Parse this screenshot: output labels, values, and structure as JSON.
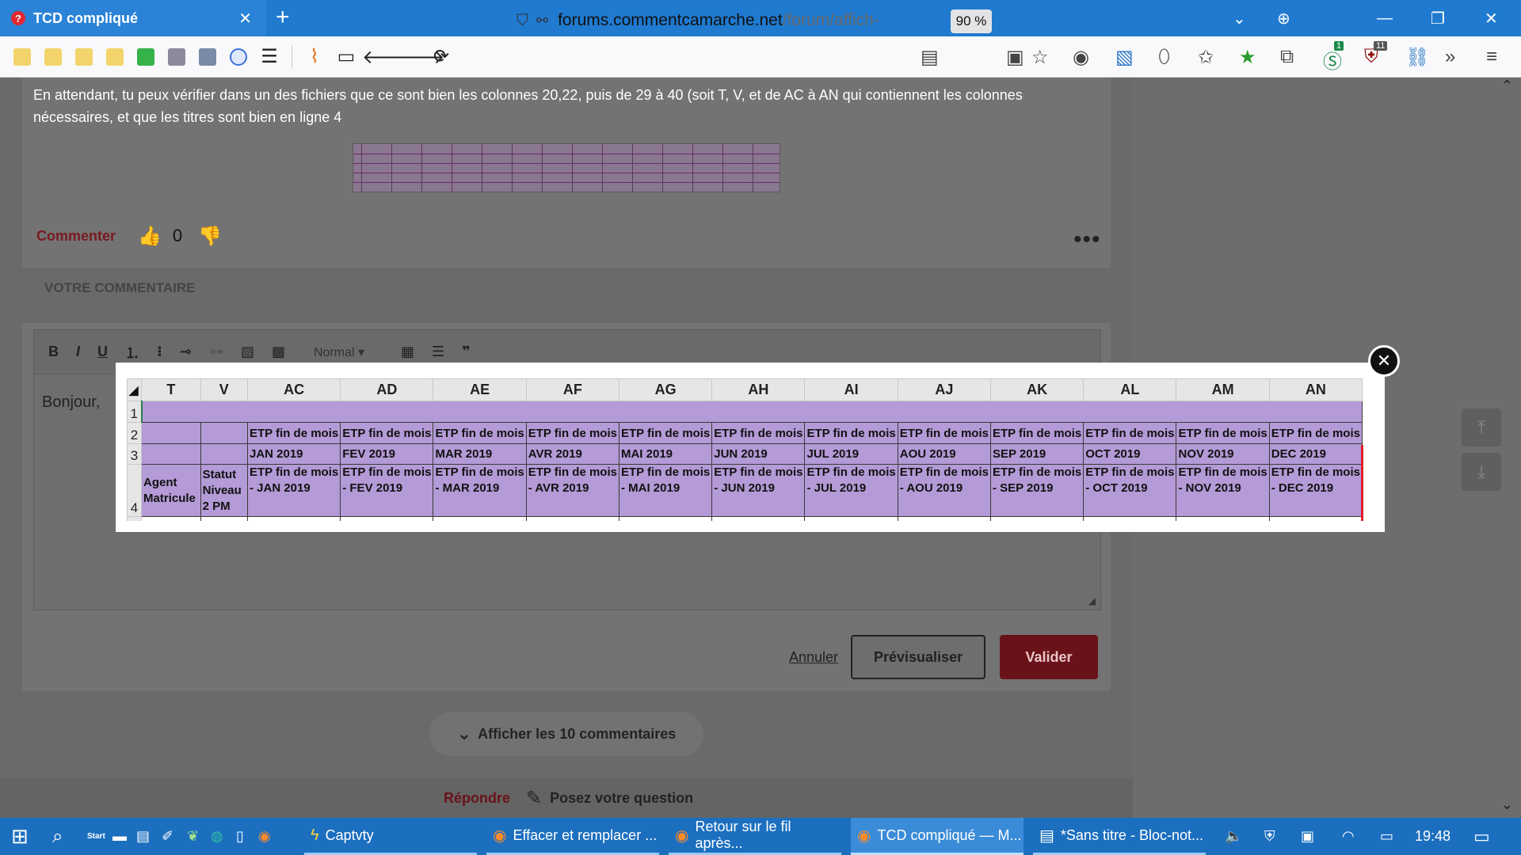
{
  "browser": {
    "tab_title": "TCD compliqué",
    "tab_close": "✕",
    "new_tab": "+",
    "url_host": "forums.commentcamarche.net",
    "url_path": "/forum/affich-",
    "zoom": "90 %",
    "badge_s": "1",
    "badge_u": "11"
  },
  "post": {
    "text": "En attendant, tu peux vérifier dans un des fichiers que ce sont bien les colonnes 20,22, puis de 29 à 40 (soit T, V, et de AC à AN qui contiennent les colonnes nécessaires, et que les titres sont bien en ligne 4",
    "comment_link": "Commenter",
    "vote_count": "0"
  },
  "comment_form": {
    "heading": "VOTRE COMMENTAIRE",
    "toolbar": {
      "bold": "B",
      "italic": "I",
      "underline": "U",
      "format": "Normal",
      "quote": "❞"
    },
    "body_text": "Bonjour,",
    "cancel": "Annuler",
    "preview": "Prévisualiser",
    "submit": "Valider"
  },
  "show_comments": "Afficher les 10 commentaires",
  "footer": {
    "reply": "Répondre",
    "ask": "Posez votre question"
  },
  "spreadsheet": {
    "columns": [
      "T",
      "V",
      "AC",
      "AD",
      "AE",
      "AF",
      "AG",
      "AH",
      "AI",
      "AJ",
      "AK",
      "AL",
      "AM",
      "AN"
    ],
    "row_numbers": [
      "1",
      "2",
      "3",
      "4"
    ],
    "row2": [
      "",
      "",
      "ETP fin de mois",
      "ETP fin de mois",
      "ETP fin de mois",
      "ETP fin de mois",
      "ETP fin de mois",
      "ETP fin de mois",
      "ETP fin de mois",
      "ETP fin de mois",
      "ETP fin de mois",
      "ETP fin de mois",
      "ETP fin de mois",
      "ETP fin de mois"
    ],
    "row3": [
      "",
      "",
      "JAN 2019",
      "FEV 2019",
      "MAR 2019",
      "AVR 2019",
      "MAI 2019",
      "JUN 2019",
      "JUL 2019",
      "AOU 2019",
      "SEP 2019",
      "OCT 2019",
      "NOV 2019",
      "DEC 2019"
    ],
    "row4": [
      "Agent Matricule",
      "Statut Niveau 2 PM",
      "ETP fin de mois - JAN 2019",
      "ETP fin de mois - FEV 2019",
      "ETP fin de mois - MAR 2019",
      "ETP fin de mois - AVR 2019",
      "ETP fin de mois - MAI 2019",
      "ETP fin de mois - JUN 2019",
      "ETP fin de mois - JUL 2019",
      "ETP fin de mois - AOU 2019",
      "ETP fin de mois - SEP 2019",
      "ETP fin de mois - OCT 2019",
      "ETP fin de mois - NOV 2019",
      "ETP fin de mois - DEC 2019"
    ]
  },
  "taskbar": {
    "start_label": "Start",
    "items": [
      "Captvty",
      "Effacer et remplacer ...",
      "Retour sur le fil après...",
      "TCD compliqué — M...",
      "*Sans titre - Bloc-not..."
    ],
    "clock": "19:48"
  },
  "colors": {
    "tabbar": "#1f7ad0",
    "brand_red": "#6a1219",
    "sheet_purple": "#b49ad6",
    "taskbar": "#1c6fbf"
  }
}
